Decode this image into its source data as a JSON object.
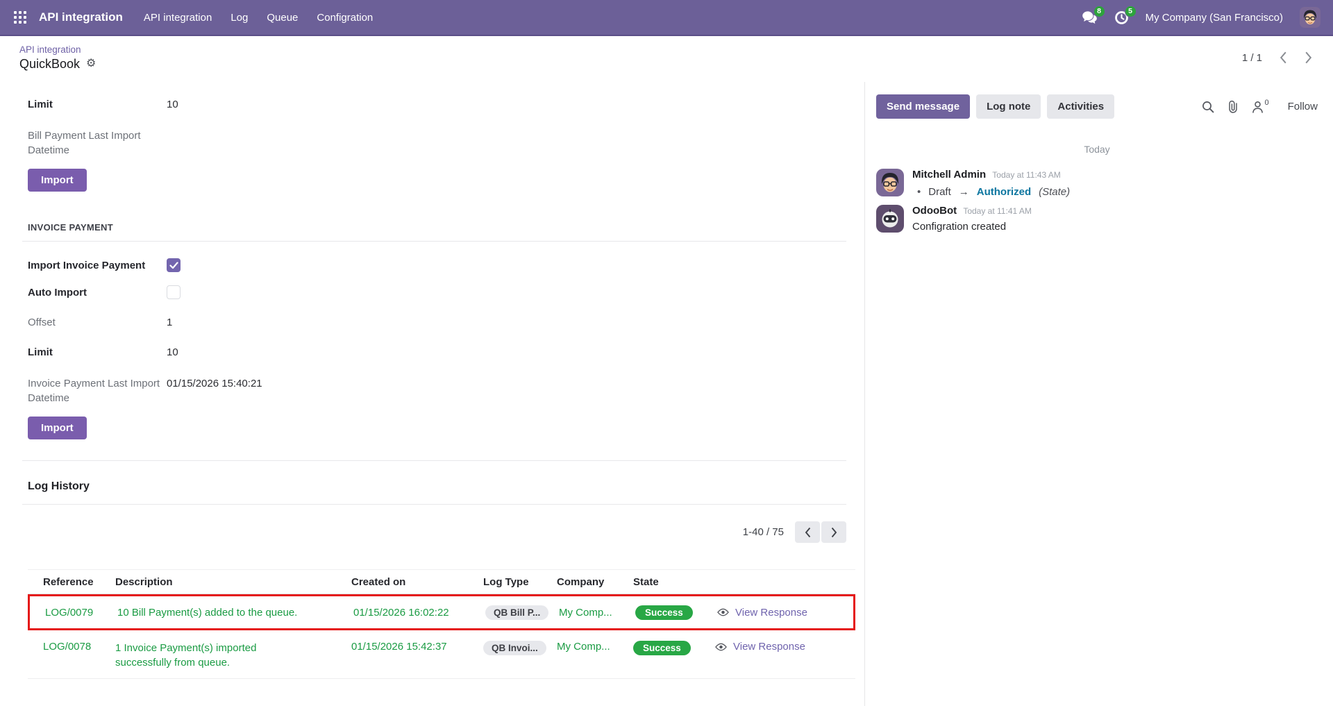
{
  "navbar": {
    "app_name": "API integration",
    "menu_items": [
      "API integration",
      "Log",
      "Queue",
      "Configration"
    ],
    "messages_badge": "8",
    "activities_badge": "5",
    "company_name": "My Company (San Francisco)"
  },
  "breadcrumb": {
    "parent": "API integration",
    "title": "QuickBook",
    "pager": "1 / 1"
  },
  "icons": {
    "gear_glyph": "⚙"
  },
  "form": {
    "bill": {
      "limit_label": "Limit",
      "limit_value": "10",
      "last_import_label": "Bill Payment Last Import Datetime",
      "import_button": "Import"
    },
    "invoice": {
      "section_title": "INVOICE PAYMENT",
      "import_invoice_label": "Import Invoice Payment",
      "auto_import_label": "Auto Import",
      "offset_label": "Offset",
      "offset_value": "1",
      "limit_label": "Limit",
      "limit_value": "10",
      "last_import_label": "Invoice Payment Last Import Datetime",
      "last_import_value": "01/15/2026 15:40:21",
      "import_button": "Import"
    }
  },
  "log_history": {
    "title": "Log History",
    "pager": "1-40 / 75",
    "table": {
      "headers": [
        "Reference",
        "Description",
        "Created on",
        "Log Type",
        "Company",
        "State"
      ],
      "rows": [
        {
          "reference": "LOG/0079",
          "description": "10 Bill Payment(s) added to the queue.",
          "created_on": "01/15/2026 16:02:22",
          "log_type": "QB Bill P...",
          "company": "My Comp...",
          "state": "Success",
          "action": "View Response"
        },
        {
          "reference": "LOG/0078",
          "description": "1 Invoice Payment(s) imported successfully from queue.",
          "created_on": "01/15/2026 15:42:37",
          "log_type": "QB Invoi...",
          "company": "My Comp...",
          "state": "Success",
          "action": "View Response"
        }
      ]
    }
  },
  "chatter": {
    "send_message_label": "Send message",
    "log_note_label": "Log note",
    "activities_label": "Activities",
    "followers_count": "0",
    "follow_label": "Follow",
    "date_divider": "Today",
    "messages": [
      {
        "author": "Mitchell Admin",
        "timestamp": "Today at 11:43 AM",
        "tracking": {
          "bullet": "•",
          "from": "Draft",
          "arrow": "→",
          "to": "Authorized",
          "field": "(State)"
        }
      },
      {
        "author": "OdooBot",
        "timestamp": "Today at 11:41 AM",
        "body": "Configration created"
      }
    ]
  },
  "colors": {
    "navbar_bg": "#6c6098",
    "primary_button": "#7a5dad",
    "success_badge": "#28a745",
    "success_text": "#1a9b43",
    "highlight_border": "#e51818",
    "tracking_to": "#0d76a0",
    "breadcrumb_link": "#6e61a6",
    "notification_badge": "#2da33c"
  }
}
